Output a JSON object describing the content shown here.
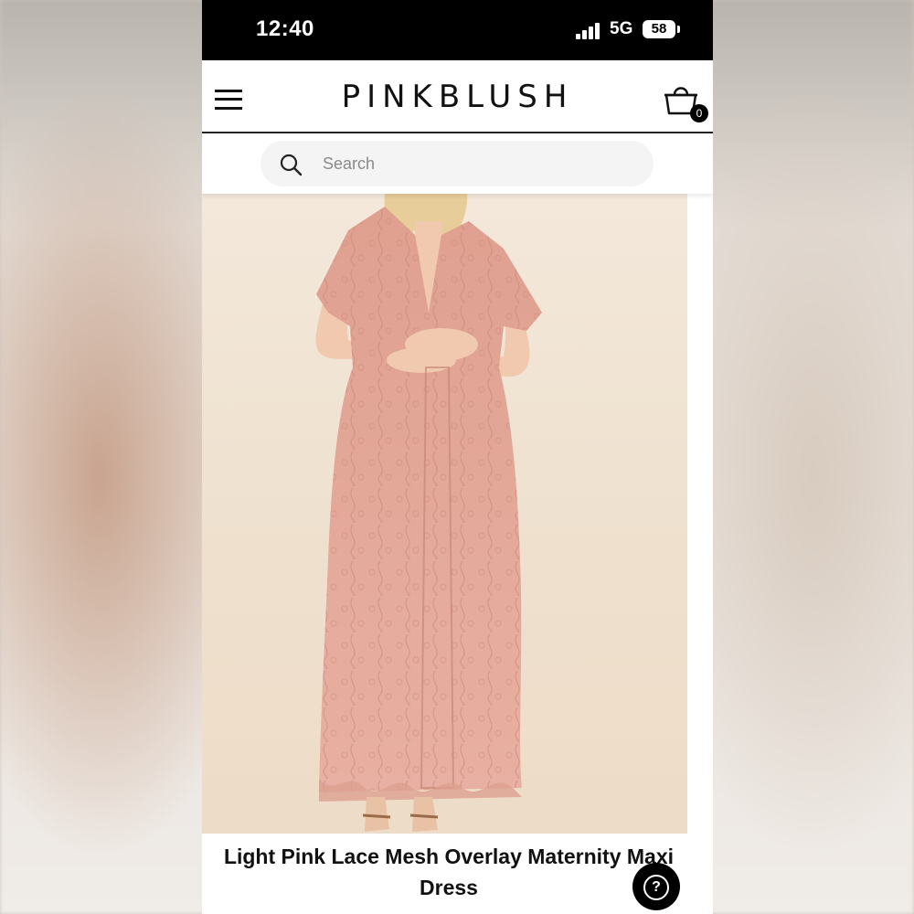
{
  "status_bar": {
    "time": "12:40",
    "network": "5G",
    "battery": "58"
  },
  "header": {
    "logo": "PINKBLUSH",
    "cart_count": "0"
  },
  "search": {
    "placeholder": "Search"
  },
  "product": {
    "title": "Light Pink Lace Mesh Overlay Maternity Maxi Dress",
    "image_alt": "light-pink-lace-maxi-dress-photo"
  },
  "help": {
    "icon": "question-icon"
  },
  "colors": {
    "status_bar_bg": "#000000",
    "dress_pink": "#e3a596",
    "photo_bg": "#f0e2d0",
    "text": "#111111"
  }
}
